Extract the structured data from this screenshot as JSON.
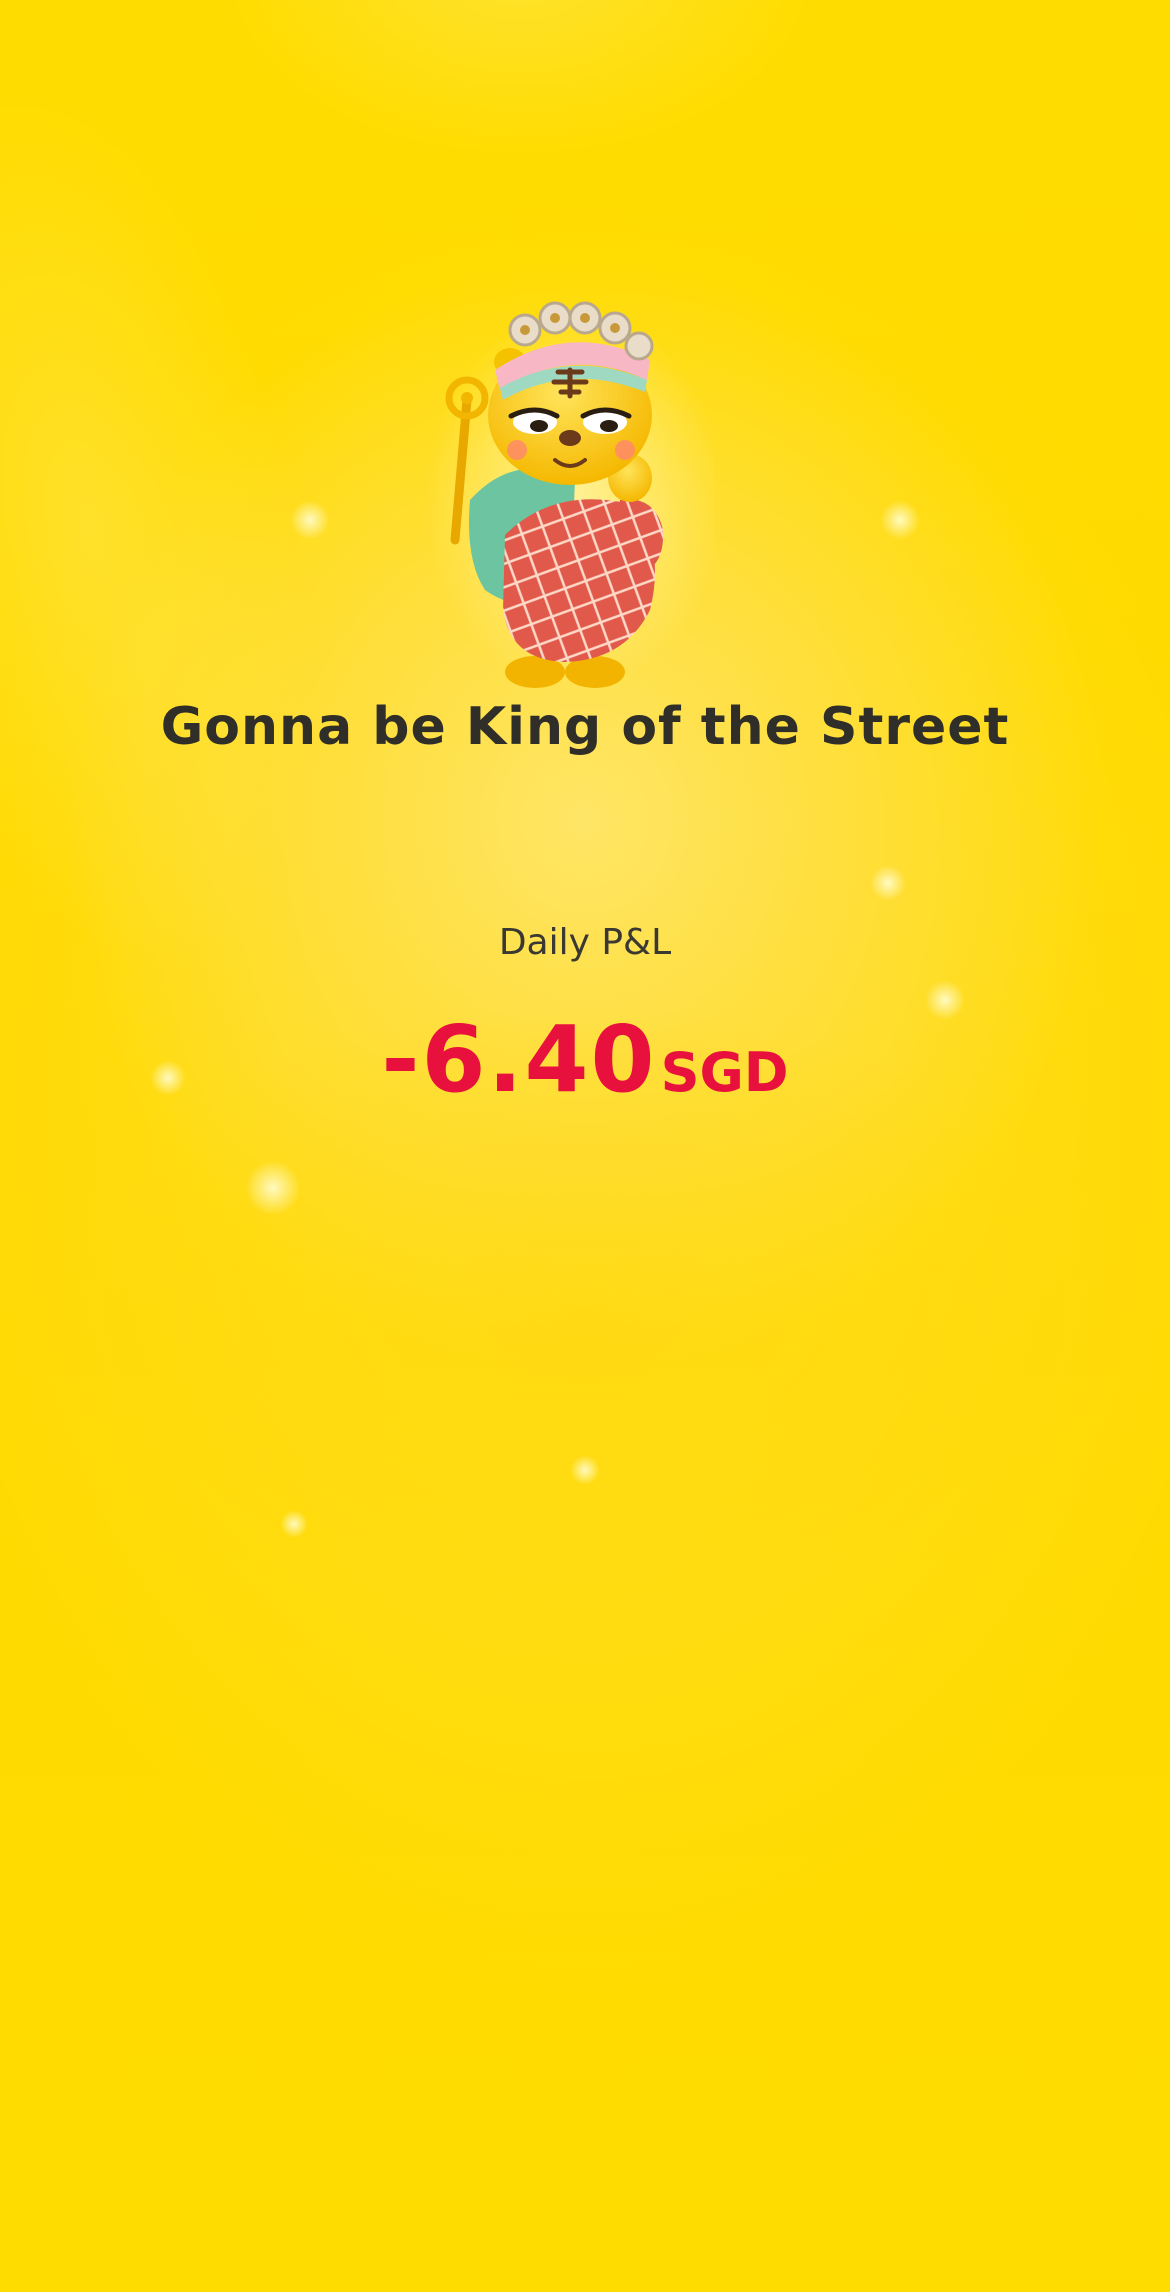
{
  "headline": "Gonna be King of the Street",
  "pnl": {
    "label": "Daily P&L",
    "amount": "-6.40",
    "currency": "SGD"
  },
  "mascot": {
    "icon": "tiger-king-mascot-icon"
  },
  "colors": {
    "background": "#ffdc00",
    "headline": "#2f2e28",
    "label": "#3a3832",
    "negative_value": "#e8103c"
  }
}
